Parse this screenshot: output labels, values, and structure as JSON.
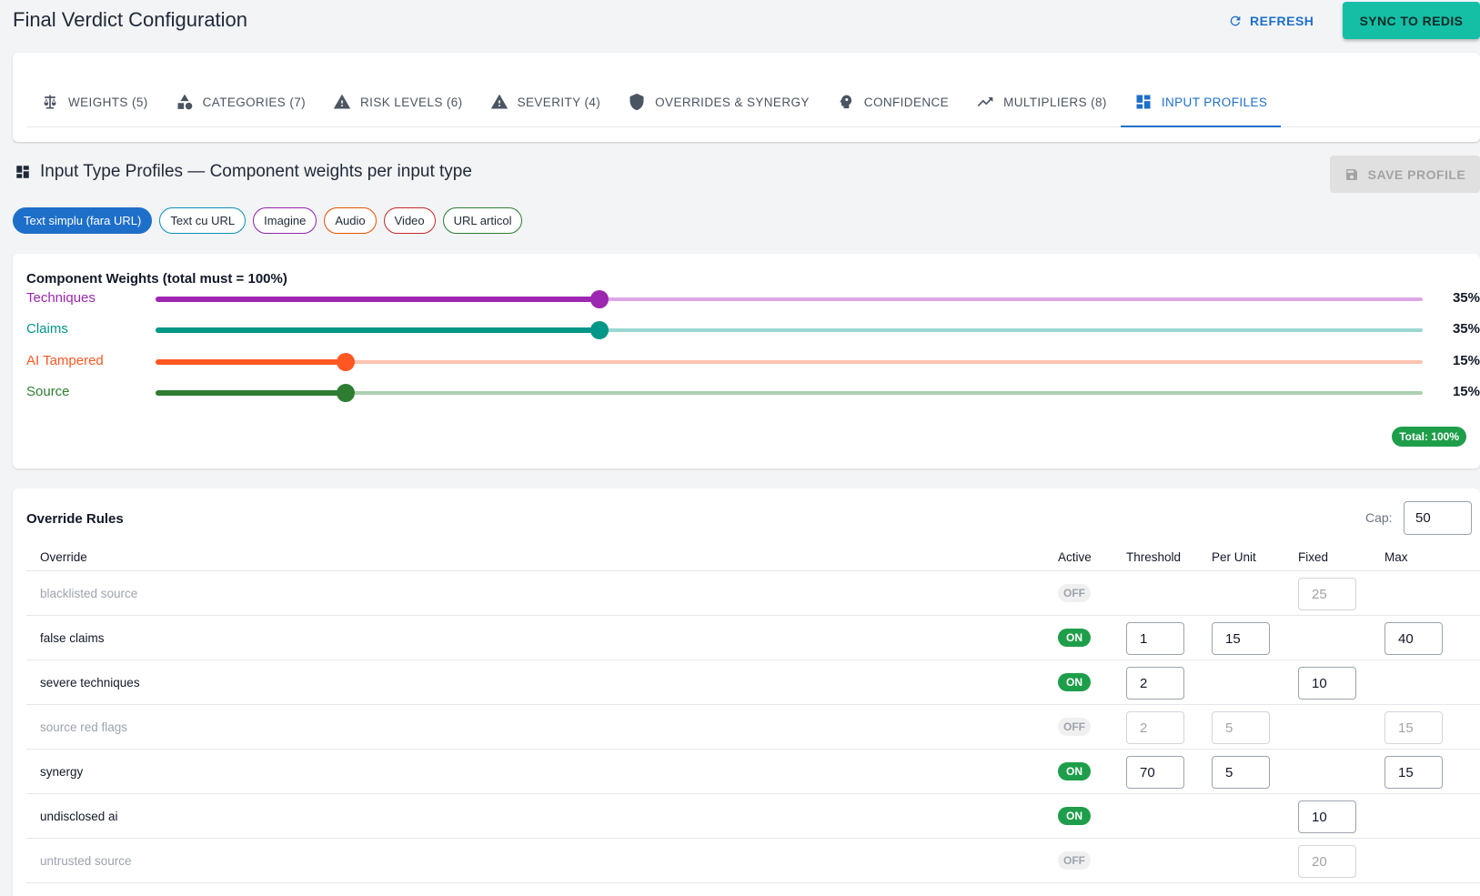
{
  "header": {
    "title": "Final Verdict Configuration",
    "refresh_label": "REFRESH",
    "sync_label": "SYNC TO REDIS"
  },
  "tabs": [
    {
      "label": "WEIGHTS (5)",
      "icon": "scale-icon"
    },
    {
      "label": "CATEGORIES (7)",
      "icon": "shapes-icon"
    },
    {
      "label": "RISK LEVELS (6)",
      "icon": "warning-icon"
    },
    {
      "label": "SEVERITY (4)",
      "icon": "warning-icon"
    },
    {
      "label": "OVERRIDES & SYNERGY",
      "icon": "shield-icon"
    },
    {
      "label": "CONFIDENCE",
      "icon": "psychology-icon"
    },
    {
      "label": "MULTIPLIERS (8)",
      "icon": "trending-up-icon"
    },
    {
      "label": "INPUT PROFILES",
      "icon": "dashboard-icon",
      "active": true
    }
  ],
  "section": {
    "title": "Input Type Profiles — Component weights per input type",
    "save_label": "SAVE PROFILE"
  },
  "profiles": [
    {
      "label": "Text simplu (fara URL)",
      "color": "#1e6fc9",
      "active": true
    },
    {
      "label": "Text cu URL",
      "color": "#0e8fb8"
    },
    {
      "label": "Imagine",
      "color": "#8e24aa"
    },
    {
      "label": "Audio",
      "color": "#e65100"
    },
    {
      "label": "Video",
      "color": "#c62828"
    },
    {
      "label": "URL articol",
      "color": "#2e7d32"
    }
  ],
  "weights": {
    "title": "Component Weights (total must = 100%)",
    "total_label": "Total: 100%",
    "items": [
      {
        "label": "Techniques",
        "percent": 35,
        "value_label": "35%",
        "color": "#9c27b0",
        "track": "#dda7e6"
      },
      {
        "label": "Claims",
        "percent": 35,
        "value_label": "35%",
        "color": "#009688",
        "track": "#9bd6d0"
      },
      {
        "label": "AI Tampered",
        "percent": 15,
        "value_label": "15%",
        "color": "#ff5722",
        "track": "#fdc3b0"
      },
      {
        "label": "Source",
        "percent": 15,
        "value_label": "15%",
        "color": "#2e7d32",
        "track": "#add0ae"
      }
    ]
  },
  "overrides": {
    "title": "Override Rules",
    "cap_label": "Cap:",
    "cap_value": "50",
    "columns": {
      "override": "Override",
      "active": "Active",
      "threshold": "Threshold",
      "per_unit": "Per Unit",
      "fixed": "Fixed",
      "max": "Max"
    },
    "rows": [
      {
        "name": "blacklisted source",
        "active": false,
        "status": "OFF",
        "threshold": null,
        "per_unit": null,
        "fixed": "25",
        "max": null
      },
      {
        "name": "false claims",
        "active": true,
        "status": "ON",
        "threshold": "1",
        "per_unit": "15",
        "fixed": null,
        "max": "40"
      },
      {
        "name": "severe techniques",
        "active": true,
        "status": "ON",
        "threshold": "2",
        "per_unit": null,
        "fixed": "10",
        "max": null
      },
      {
        "name": "source red flags",
        "active": false,
        "status": "OFF",
        "threshold": "2",
        "per_unit": "5",
        "fixed": null,
        "max": "15"
      },
      {
        "name": "synergy",
        "active": true,
        "status": "ON",
        "threshold": "70",
        "per_unit": "5",
        "fixed": null,
        "max": "15"
      },
      {
        "name": "undisclosed ai",
        "active": true,
        "status": "ON",
        "threshold": null,
        "per_unit": null,
        "fixed": "10",
        "max": null
      },
      {
        "name": "untrusted source",
        "active": false,
        "status": "OFF",
        "threshold": null,
        "per_unit": null,
        "fixed": "20",
        "max": null
      }
    ]
  }
}
